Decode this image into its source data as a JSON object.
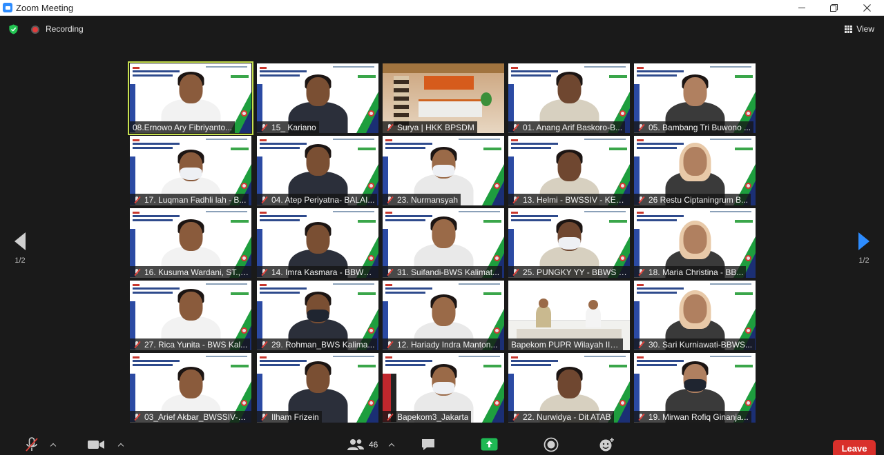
{
  "window": {
    "title": "Zoom Meeting",
    "controls": [
      "minimize",
      "restore",
      "close"
    ]
  },
  "meeting": {
    "recording_label": "Recording",
    "view_label": "View",
    "page_indicator": "1/2"
  },
  "participants": [
    {
      "name": "08.Ernowo Ary Fibriyanto...",
      "kind": "slide",
      "speaking": true,
      "muted": false
    },
    {
      "name": "15_ Kariano",
      "kind": "slide",
      "speaking": false,
      "muted": true
    },
    {
      "name": "Surya | HKK BPSDM",
      "kind": "room",
      "speaking": false,
      "muted": true
    },
    {
      "name": "01. Anang Arif Baskoro-B...",
      "kind": "slide",
      "speaking": false,
      "muted": true
    },
    {
      "name": "05. Bambang Tri Buwono ...",
      "kind": "slide",
      "speaking": false,
      "muted": true
    },
    {
      "name": "17. Luqman Fadhli lah - B...",
      "kind": "slide",
      "speaking": false,
      "muted": true
    },
    {
      "name": "04. Atep Periyatna- BALAI...",
      "kind": "slide",
      "speaking": false,
      "muted": true
    },
    {
      "name": "23. Nurmansyah",
      "kind": "slide",
      "speaking": false,
      "muted": true
    },
    {
      "name": "13. Helmi - BWSSIV - KEP...",
      "kind": "slide",
      "speaking": false,
      "muted": true
    },
    {
      "name": "26 Restu Ciptaningrum B...",
      "kind": "slide",
      "speaking": false,
      "muted": true
    },
    {
      "name": "16. Kusuma Wardani, ST., ...",
      "kind": "slide",
      "speaking": false,
      "muted": true
    },
    {
      "name": "14. Imra Kasmara - BBWS...",
      "kind": "slide",
      "speaking": false,
      "muted": true
    },
    {
      "name": "31. Suifandi-BWS Kalimat...",
      "kind": "slide",
      "speaking": false,
      "muted": true
    },
    {
      "name": "25. PUNGKY YY - BBWS C...",
      "kind": "slide",
      "speaking": false,
      "muted": true
    },
    {
      "name": "18. Maria Christina - BB...",
      "kind": "slide",
      "speaking": false,
      "muted": true
    },
    {
      "name": "27. Rica Yunita - BWS Kal...",
      "kind": "slide",
      "speaking": false,
      "muted": true
    },
    {
      "name": "29. Rohman_BWS Kalima...",
      "kind": "slide",
      "speaking": false,
      "muted": true
    },
    {
      "name": "12. Hariady Indra Manton...",
      "kind": "slide",
      "speaking": false,
      "muted": true
    },
    {
      "name": "Bapekom PUPR Wilayah III J...",
      "kind": "bapekom",
      "speaking": false,
      "muted": false
    },
    {
      "name": "30. Sari Kurniawati-BBWS...",
      "kind": "slide",
      "speaking": false,
      "muted": true
    },
    {
      "name": "03_Arief Akbar_BWSSIV-K...",
      "kind": "slide",
      "speaking": false,
      "muted": true
    },
    {
      "name": "Ilham Frizein",
      "kind": "slide",
      "speaking": false,
      "muted": true
    },
    {
      "name": "Bapekom3_Jakarta",
      "kind": "slide2",
      "speaking": false,
      "muted": true
    },
    {
      "name": "22. Nurwidya - Dit ATAB",
      "kind": "slide",
      "speaking": false,
      "muted": true
    },
    {
      "name": "19. Mirwan Rofiq Ginanja...",
      "kind": "slide",
      "speaking": false,
      "muted": true
    }
  ],
  "toolbar": {
    "participants_count": "46",
    "leave_label": "Leave"
  },
  "colors": {
    "accent_blue": "#2d8cff",
    "active_speaker_outline": "#c7e14f",
    "leave_red": "#d9302b",
    "share_green": "#1fb954"
  }
}
